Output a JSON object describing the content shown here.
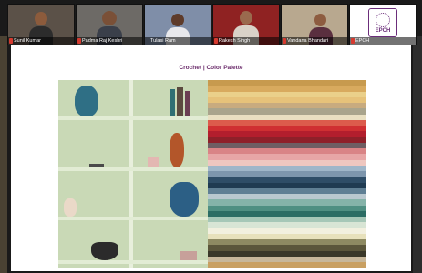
{
  "participants": [
    {
      "name": "Sunil Kumar",
      "muted": true
    },
    {
      "name": "Padma Raj Keshri",
      "muted": true
    },
    {
      "name": "Tulasi Ram",
      "muted": false
    },
    {
      "name": "Rakesh Singh",
      "muted": true
    },
    {
      "name": "Vandana Bhandari",
      "muted": true
    },
    {
      "name": "EPCH",
      "muted": true
    }
  ],
  "logo": {
    "text": "EPCH"
  },
  "slide": {
    "title": "Crochet | Color Palette"
  },
  "palette": [
    "#c79a4e",
    "#d8aa5e",
    "#ead08a",
    "#e6c27a",
    "#c8ab7f",
    "#a9a48c",
    "#e9dfc1",
    "#dc5b4c",
    "#cf2f32",
    "#b31e2d",
    "#8e2029",
    "#6e5e63",
    "#d98486",
    "#e7a6a6",
    "#efc7c0",
    "#9fb6c9",
    "#7d96ad",
    "#2e4d67",
    "#1f3b52",
    "#5f7f94",
    "#b9c8cf",
    "#85b3a9",
    "#4f8f82",
    "#2b6d64",
    "#a6c7b7",
    "#d8e5d5",
    "#f2f0df",
    "#e7e1bc",
    "#8e8a62",
    "#5b563b",
    "#3a3829",
    "#c7b79a",
    "#c9a062"
  ]
}
